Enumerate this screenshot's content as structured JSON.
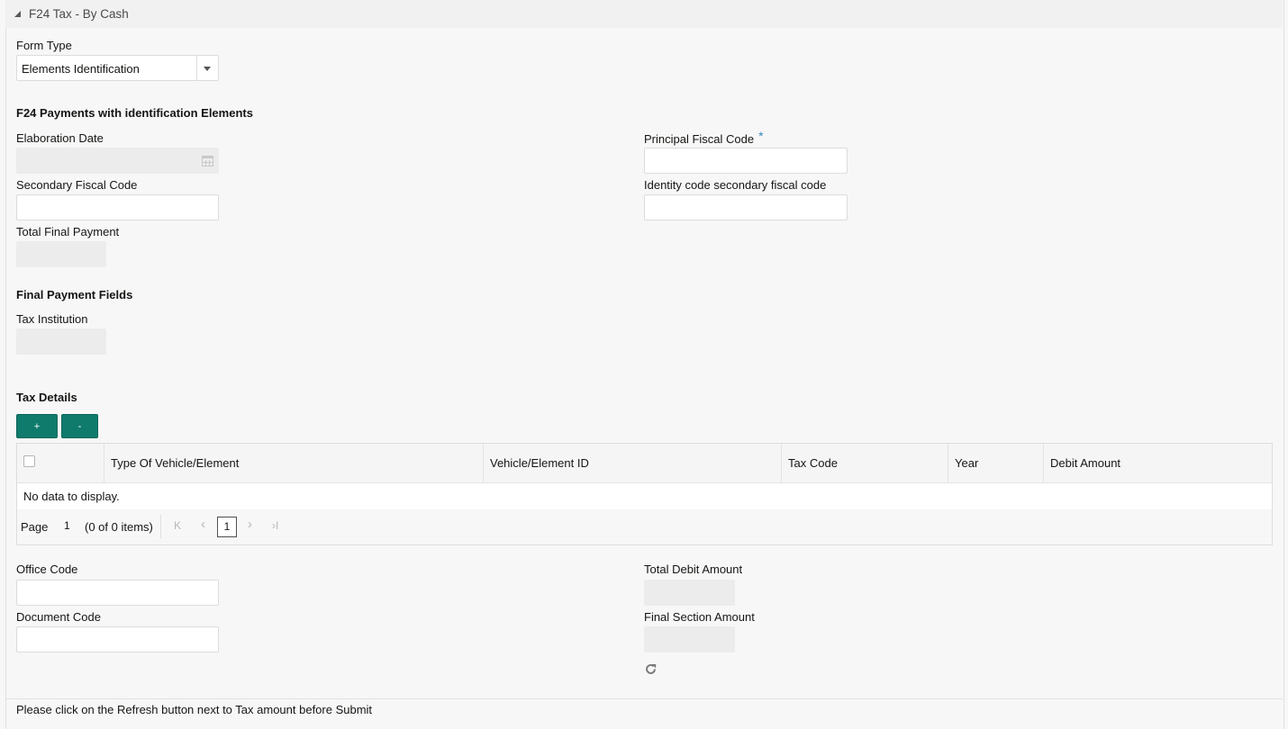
{
  "section": {
    "title": "F24 Tax - By Cash"
  },
  "form_type": {
    "label": "Form Type",
    "selected": "Elements Identification"
  },
  "identification": {
    "heading": "F24 Payments with identification Elements",
    "elaboration_date_label": "Elaboration Date",
    "principal_fiscal_code_label": "Principal Fiscal Code",
    "required_mark": "*",
    "secondary_fiscal_code_label": "Secondary Fiscal Code",
    "identity_code_label": "Identity code secondary fiscal code",
    "total_final_payment_label": "Total Final Payment"
  },
  "final_payment": {
    "heading": "Final Payment Fields",
    "tax_institution_label": "Tax Institution"
  },
  "tax_details": {
    "heading": "Tax Details",
    "add_label": "+",
    "remove_label": "-",
    "columns": [
      "Type Of Vehicle/Element",
      "Vehicle/Element ID",
      "Tax Code",
      "Year",
      "Debit Amount"
    ],
    "empty_message": "No data to display.",
    "pager": {
      "page_label": "Page",
      "page_value": "1",
      "items_text": "(0 of 0 items)",
      "first": "K",
      "prev": "‹",
      "current": "1",
      "next": "›",
      "last": "›I"
    }
  },
  "totals": {
    "office_code_label": "Office Code",
    "document_code_label": "Document Code",
    "total_debit_amount_label": "Total Debit Amount",
    "final_section_amount_label": "Final Section Amount"
  },
  "footer": {
    "note": "Please click on the Refresh button next to Tax amount before Submit"
  }
}
